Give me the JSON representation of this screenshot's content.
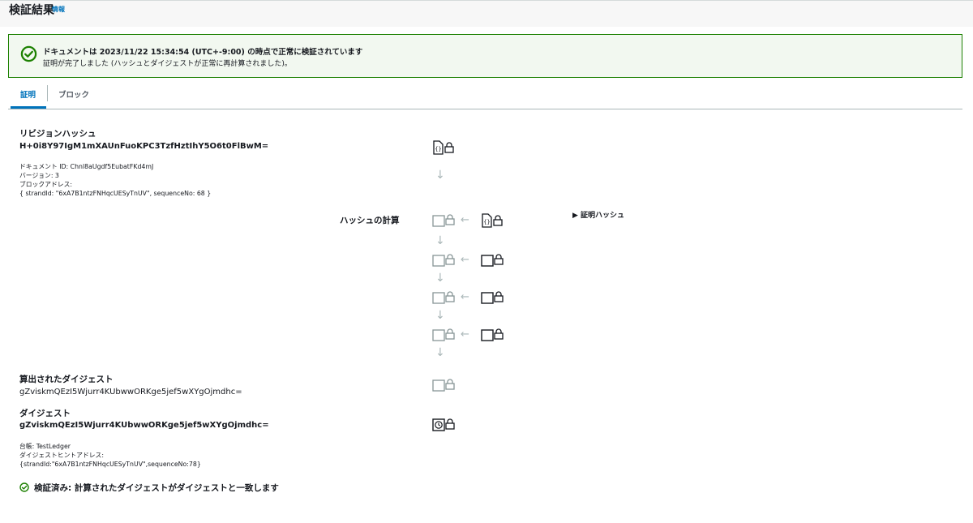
{
  "page": {
    "title": "検証結果",
    "info_link": "情報"
  },
  "alert": {
    "title": "ドキュメントは 2023/11/22 15:34:54 (UTC+-9:00) の時点で正常に検証されています",
    "description": "証明が完了しました (ハッシュとダイジェストが正常に再計算されました)。",
    "icon": "check-circle-icon",
    "color": "#1d8102"
  },
  "tabs": [
    {
      "label": "証明",
      "active": true
    },
    {
      "label": "ブロック",
      "active": false
    }
  ],
  "revision": {
    "heading": "リビジョンハッシュ",
    "hash": "H+0i8Y97IgM1mXAUnFuoKPC3TzfHztIhY5O6t0FlBwM=",
    "document_id": "ドキュメント ID: Chnl8aUgdf5EubatFKd4mJ",
    "version": "バージョン: 3",
    "block_address_label": "ブロックアドレス:",
    "block_address": "{ strandId: \"6xA7B1ntzFNHqcUESyTnUV\", sequenceNo: 68 }"
  },
  "hash_calc": {
    "label": "ハッシュの計算",
    "proof_toggle": "▶ 証明ハッシュ"
  },
  "computed_digest": {
    "heading": "算出されたダイジェスト",
    "value": "gZviskmQEzI5Wjurr4KUbwwORKge5jef5wXYgOjmdhc="
  },
  "digest": {
    "heading": "ダイジェスト",
    "value": "gZviskmQEzI5Wjurr4KUbwwORKge5jef5wXYgOjmdhc=",
    "ledger": "台帳: TestLedger",
    "tip_address_label": "ダイジェストヒントアドレス:",
    "tip_address": "{strandId:\"6xA7B1ntzFNHqcUESyTnUV\",sequenceNo:78}"
  },
  "verified": {
    "text": "検証済み: 計算されたダイジェストがダイジェストと一致します",
    "icon": "check-circle-icon"
  }
}
